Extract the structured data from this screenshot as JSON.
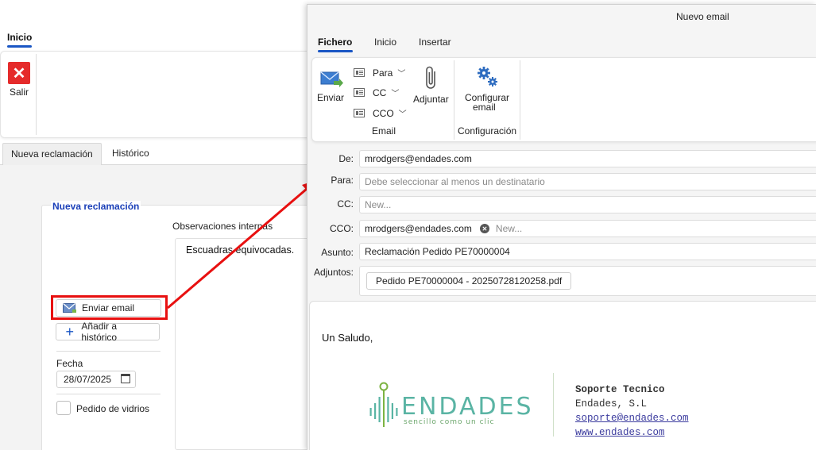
{
  "background": {
    "ribbon_tab": "Inicio",
    "exit_label": "Salir",
    "tabs": [
      "Nueva reclamación",
      "Histórico"
    ],
    "card_title": "Nueva reclamación",
    "obs_label": "Observaciones internas",
    "obs_text": "Escuadras equivocadas.",
    "send_email_label": "Enviar email",
    "add_history_label": "Añadir a histórico",
    "date_label": "Fecha",
    "date_value": "28/07/2025",
    "glass_order_label": "Pedido de vidrios"
  },
  "dialog": {
    "title": "Nuevo email",
    "tabs": [
      "Fichero",
      "Inicio",
      "Insertar"
    ],
    "ribbon": {
      "send_label": "Enviar",
      "to_label": "Para",
      "cc_label": "CC",
      "bcc_label": "CCO",
      "attach_label": "Adjuntar",
      "group_email": "Email",
      "config_label_line1": "Configurar",
      "config_label_line2": "email",
      "group_config": "Configuración"
    },
    "fields": {
      "from_label": "De:",
      "from_value": "mrodgers@endades.com",
      "to_label": "Para:",
      "to_placeholder": "Debe seleccionar al menos un destinatario",
      "cc_label": "CC:",
      "cc_placeholder": "New...",
      "bcc_label": "CCO:",
      "bcc_chip": "mrodgers@endades.com",
      "bcc_placeholder": "New...",
      "subject_label": "Asunto:",
      "subject_value": "Reclamación Pedido PE70000004",
      "attachments_label": "Adjuntos:",
      "attachment_file": "Pedido PE70000004 - 20250728120258.pdf"
    },
    "body": {
      "greeting": "Un Saludo,",
      "logo_word": "ENDADES",
      "logo_tagline": "sencillo como un clic",
      "signature": {
        "name": "Soporte Tecnico",
        "company": "Endades, S.L",
        "email": "soporte@endades.com",
        "web": "www.endades.com"
      }
    }
  },
  "colors": {
    "accent_blue": "#1a56c4",
    "highlight_red": "#e81010",
    "exit_red": "#e52b2b",
    "logo_teal": "#5ab4a4"
  }
}
